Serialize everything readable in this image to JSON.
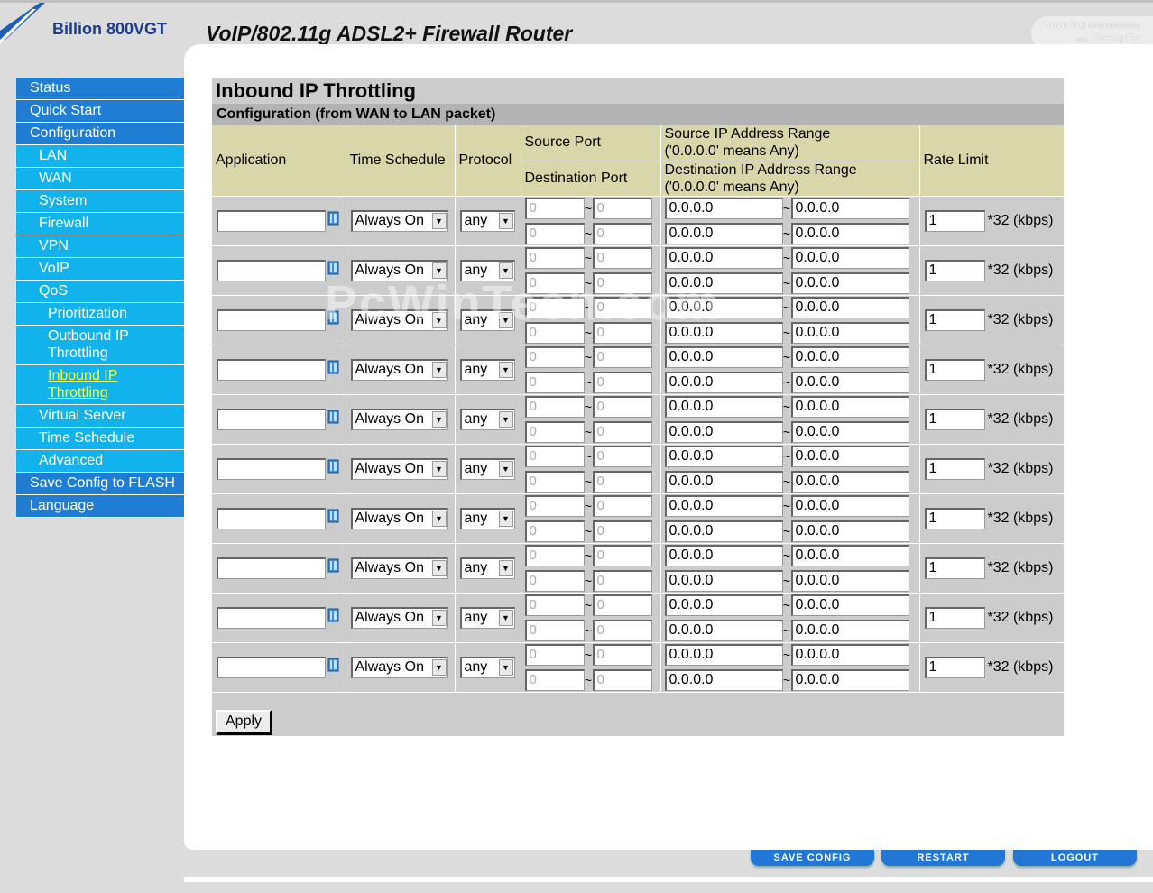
{
  "header": {
    "model": "Billion 800VGT",
    "product": "VoIP/802.11g ADSL2+ Firewall Router",
    "slogan_prefix": "Powering",
    "slogan_small1": "communications",
    "slogan_small2": "with",
    "slogan_main": "Security"
  },
  "sidebar": {
    "items": [
      {
        "label": "Status"
      },
      {
        "label": "Quick Start"
      },
      {
        "label": "Configuration"
      },
      {
        "label": "LAN"
      },
      {
        "label": "WAN"
      },
      {
        "label": "System"
      },
      {
        "label": "Firewall"
      },
      {
        "label": "VPN"
      },
      {
        "label": "VoIP"
      },
      {
        "label": "QoS"
      },
      {
        "label": "Prioritization"
      },
      {
        "label": "Outbound IP Throttling"
      },
      {
        "label": "Inbound IP Throttling"
      },
      {
        "label": "Virtual Server"
      },
      {
        "label": "Time Schedule"
      },
      {
        "label": "Advanced"
      },
      {
        "label": "Save Config to FLASH"
      },
      {
        "label": "Language"
      }
    ]
  },
  "main": {
    "title": "Inbound IP Throttling",
    "section": "Configuration (from WAN to LAN packet)",
    "columns": {
      "application": "Application",
      "time_schedule": "Time Schedule",
      "protocol": "Protocol",
      "source_port": "Source Port",
      "destination_port": "Destination Port",
      "source_ip": "Source IP Address Range",
      "source_ip_note": "('0.0.0.0' means Any)",
      "destination_ip": "Destination IP Address Range",
      "destination_ip_note": "('0.0.0.0' means Any)",
      "rate_limit": "Rate Limit"
    },
    "defaults": {
      "application": "",
      "time_schedule": "Always On",
      "protocol": "any",
      "port": "0",
      "ip": "0.0.0.0",
      "rate": "1",
      "rate_unit": "*32 (kbps)",
      "tilde": "~"
    },
    "row_count": 10,
    "apply_label": "Apply"
  },
  "footer": {
    "save_config": "SAVE CONFIG",
    "restart": "RESTART",
    "logout": "LOGOUT"
  },
  "watermark": "PcWinTech.com",
  "colors": {
    "nav_primary": "#1f7dd3",
    "nav_secondary": "#12b2ec",
    "nav_active_text": "#ffff33",
    "header_cells": "#d9d7a9",
    "footer_buttons": "#2277d6"
  }
}
